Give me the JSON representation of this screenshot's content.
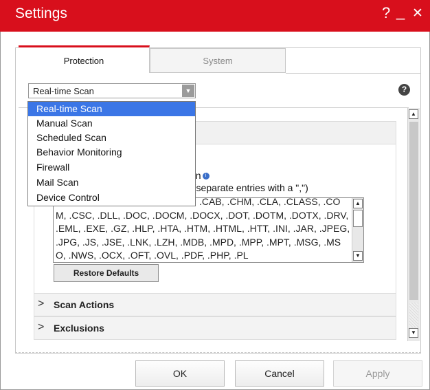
{
  "window": {
    "title": "Settings",
    "help_glyph": "?",
    "minimize_glyph": "_",
    "close_glyph": "✕"
  },
  "tabs": [
    {
      "label": "Protection",
      "active": true
    },
    {
      "label": "System",
      "active": false
    }
  ],
  "scan_select": {
    "selected": "Real-time Scan",
    "options": [
      "Real-time Scan",
      "Manual Scan",
      "Scheduled Scan",
      "Behavior Monitoring",
      "Firewall",
      "Mail Scan",
      "Device Control"
    ]
  },
  "help_button": "?",
  "content": {
    "scan_checkbox_label_partial": "can",
    "extensions_label_partial": "s (separate entries with a \",\")",
    "extensions_text": "ACCDB, .ARJ, .BAT, .BIN, .BOO, .CAB, .CHM, .CLA, .CLASS, .COM, .CSC, .DLL, .DOC, .DOCM, .DOCX, .DOT, .DOTM, .DOTX, .DRV, .EML, .EXE, .GZ, .HLP, .HTA, .HTM, .HTML, .HTT, .INI, .JAR, .JPEG, .JPG, .JS, .JSE, .LNK, .LZH, .MDB, .MPD, .MPP, .MPT, .MSG, .MSO, .NWS, .OCX, .OFT, .OVL, .PDF, .PHP, .PL",
    "restore_defaults": "Restore Defaults"
  },
  "accordion": [
    {
      "label": "Scan Actions",
      "chevron": ">"
    },
    {
      "label": "Exclusions",
      "chevron": ">"
    }
  ],
  "footer": {
    "ok": "OK",
    "cancel": "Cancel",
    "apply": "Apply"
  },
  "colors": {
    "brand_red": "#d80f1c",
    "selection_blue": "#3b76e6"
  }
}
